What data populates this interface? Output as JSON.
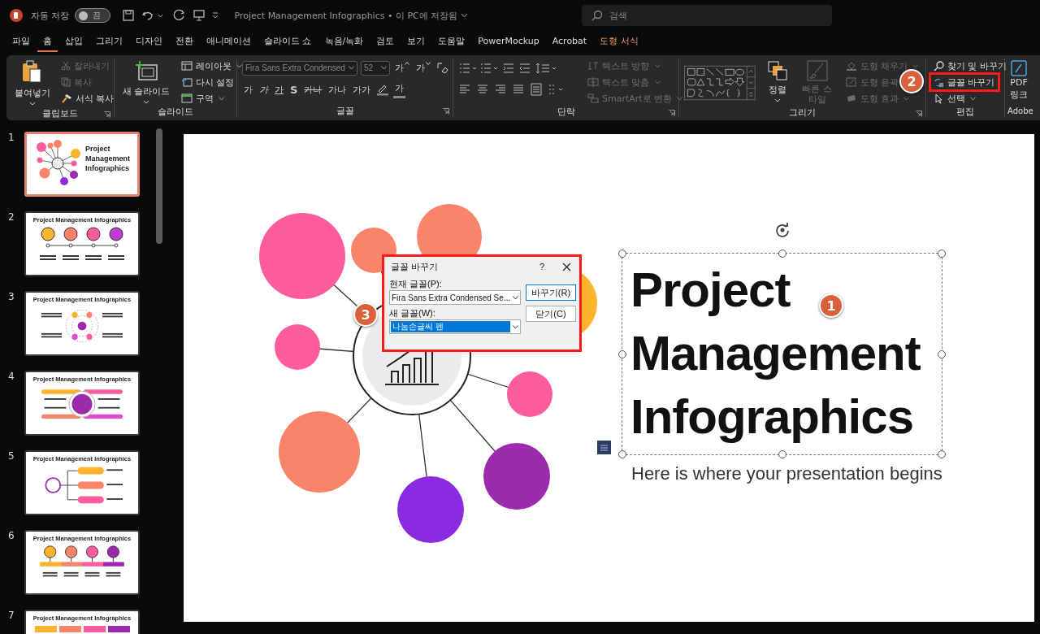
{
  "title_bar": {
    "autosave_label": "자동 저장",
    "autosave": {
      "on": false,
      "label": "끔"
    },
    "document_title": "Project Management Infographics • 이 PC에 저장됨",
    "search": {
      "placeholder": "검색"
    }
  },
  "menu_tabs": [
    {
      "label": "파일",
      "selected": false,
      "contextual": false
    },
    {
      "label": "홈",
      "selected": true,
      "contextual": false
    },
    {
      "label": "삽입",
      "selected": false,
      "contextual": false
    },
    {
      "label": "그리기",
      "selected": false,
      "contextual": false
    },
    {
      "label": "디자인",
      "selected": false,
      "contextual": false
    },
    {
      "label": "전환",
      "selected": false,
      "contextual": false
    },
    {
      "label": "애니메이션",
      "selected": false,
      "contextual": false
    },
    {
      "label": "슬라이드 쇼",
      "selected": false,
      "contextual": false
    },
    {
      "label": "녹음/녹화",
      "selected": false,
      "contextual": false
    },
    {
      "label": "검토",
      "selected": false,
      "contextual": false
    },
    {
      "label": "보기",
      "selected": false,
      "contextual": false
    },
    {
      "label": "도움말",
      "selected": false,
      "contextual": false
    },
    {
      "label": "PowerMockup",
      "selected": false,
      "contextual": false
    },
    {
      "label": "Acrobat",
      "selected": false,
      "contextual": false
    },
    {
      "label": "도형 서식",
      "selected": false,
      "contextual": true
    }
  ],
  "ribbon": {
    "clipboard": {
      "name": "클립보드",
      "paste": "붙여넣기",
      "cut": {
        "label": "잘라내기",
        "disabled": true
      },
      "copy": {
        "label": "복사",
        "disabled": true
      },
      "format_painter": {
        "label": "서식 복사",
        "disabled": false
      }
    },
    "slides": {
      "name": "슬라이드",
      "new_slide": "새 슬라이드",
      "layout": "레이아웃",
      "reset": "다시 설정",
      "section": "구역"
    },
    "font": {
      "name": "글꼴",
      "font_name": "Fira Sans Extra Condensed",
      "font_size": "52",
      "grow": "가",
      "shrink": "가",
      "format_buttons": [
        "가",
        "가",
        "가",
        "S",
        "가나",
        "가나",
        "가가"
      ],
      "font_color": "가"
    },
    "paragraph": {
      "name": "단락",
      "text_direction": {
        "label": "텍스트 방향",
        "disabled": true
      },
      "align_text": {
        "label": "텍스트 맞춤",
        "disabled": true
      },
      "smartart": {
        "label": "SmartArt로 변환",
        "disabled": true
      }
    },
    "drawing": {
      "name": "그리기",
      "arrange": "정렬",
      "quick_styles": {
        "label": "빠른 스타일",
        "disabled": true
      },
      "shape_fill": {
        "label": "도형 채우기",
        "disabled": true
      },
      "shape_outline": {
        "label": "도형 윤곽",
        "disabled": true
      },
      "shape_effects": {
        "label": "도형 효과",
        "disabled": true
      }
    },
    "editing": {
      "name": "편집",
      "find_replace": "찾기 및 바꾸기",
      "replace_fonts": {
        "label": "글꼴 바꾸기",
        "highlighted": true
      },
      "select": "선택"
    },
    "adobe": {
      "name": "Adobe",
      "pdf_button": "PDF",
      "pdf_button_line2": "링크"
    }
  },
  "thumbnails": [
    {
      "number": "1",
      "selected": true,
      "kind": "cover",
      "title": "Project Management Infographics"
    },
    {
      "number": "2",
      "selected": false,
      "kind": "circles",
      "title": "Project Management Infographics"
    },
    {
      "number": "3",
      "selected": false,
      "kind": "orbit",
      "title": "Project Management Infographics"
    },
    {
      "number": "4",
      "selected": false,
      "kind": "banners",
      "title": "Project Management Infographics"
    },
    {
      "number": "5",
      "selected": false,
      "kind": "branches",
      "title": "Project Management Infographics"
    },
    {
      "number": "6",
      "selected": false,
      "kind": "timeline",
      "title": "Project Management Infographics"
    },
    {
      "number": "7",
      "selected": false,
      "kind": "boxes",
      "title": "Project Management Infographics"
    }
  ],
  "slide": {
    "title_lines": [
      "Project",
      "Management",
      "Infographics"
    ],
    "subtitle": "Here is where your presentation begins",
    "title_selected": true
  },
  "dialog": {
    "title": "글꼴 바꾸기",
    "help": "?",
    "current_font": {
      "label": "현재 글꼴(P):",
      "value": "Fira Sans Extra Condensed Se..."
    },
    "new_font": {
      "label": "새 글꼴(W):",
      "value": "나눔손글씨 펜"
    },
    "buttons": [
      {
        "label": "바꾸기(R)",
        "default": true
      },
      {
        "label": "닫기(C)",
        "default": false
      }
    ],
    "highlighted": true
  },
  "callouts": [
    "1",
    "2",
    "3"
  ]
}
